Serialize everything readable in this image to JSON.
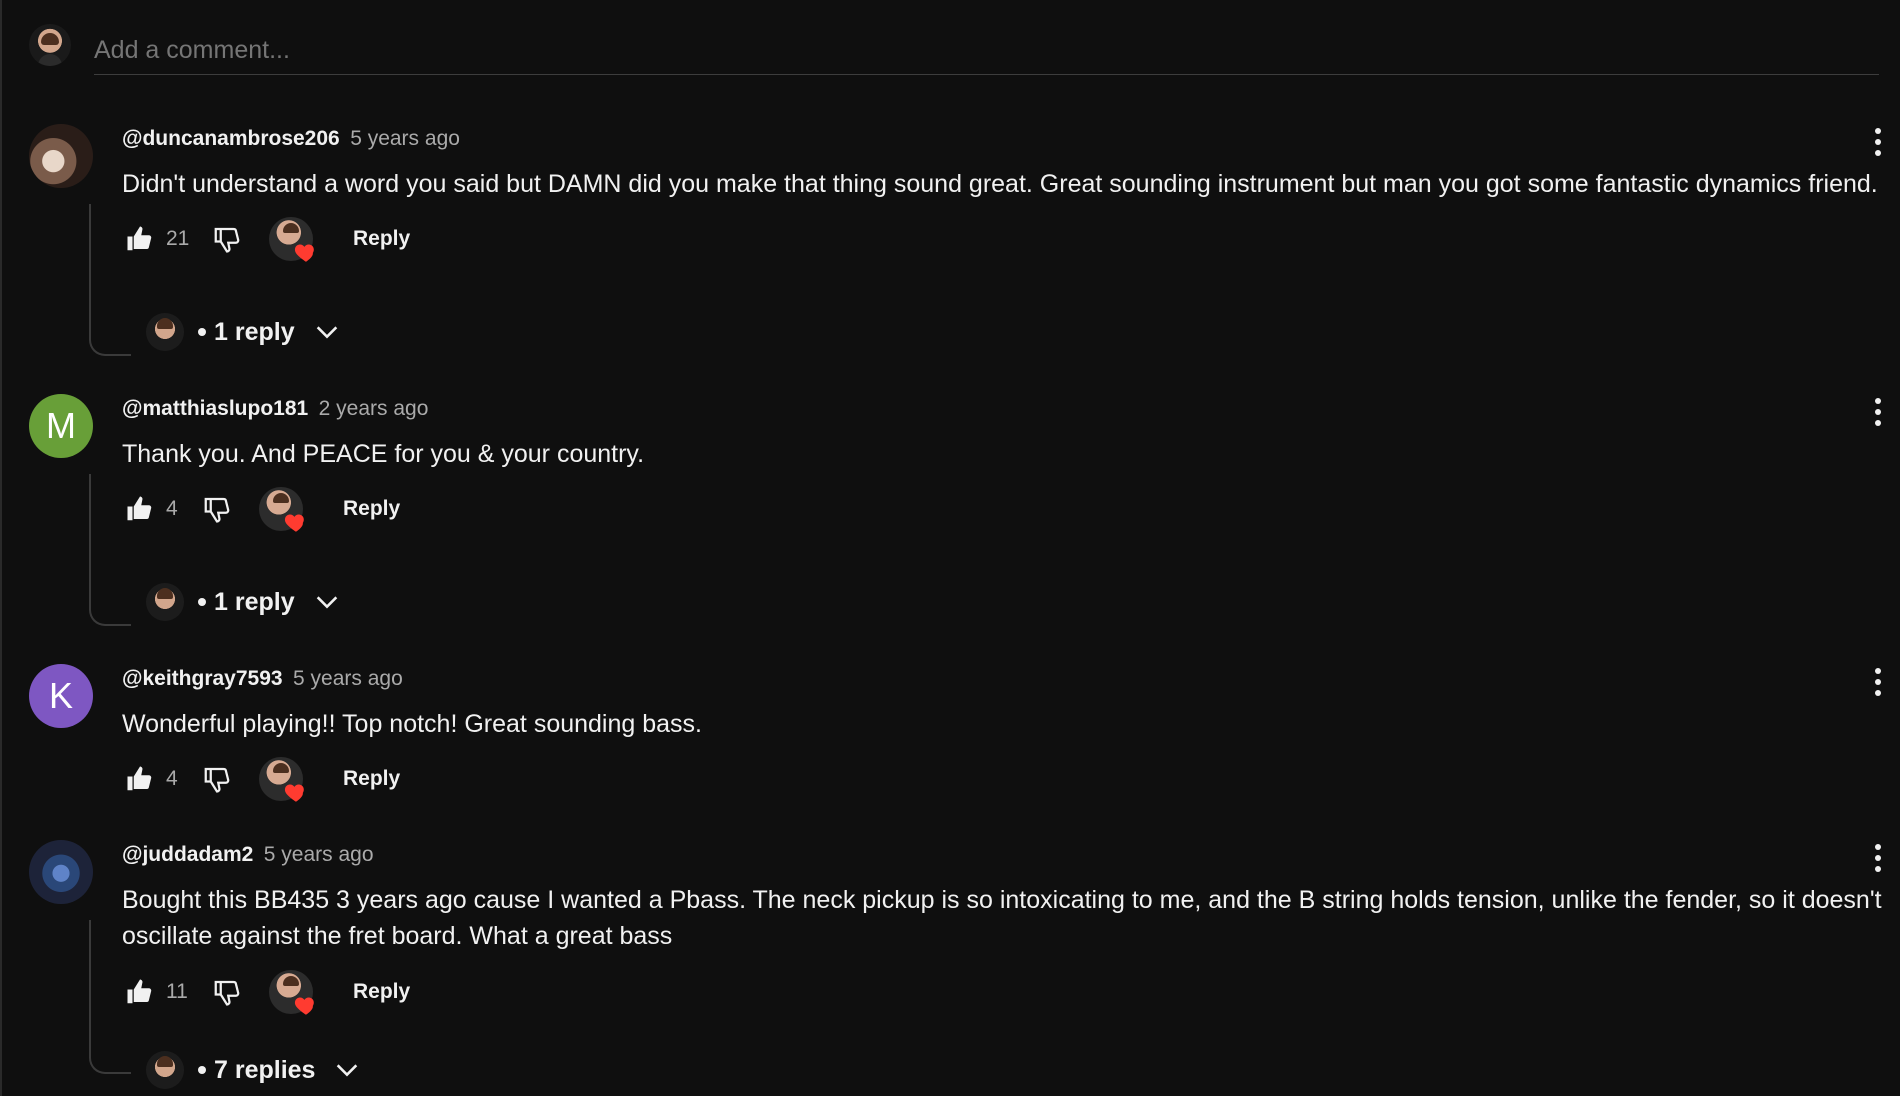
{
  "composer": {
    "placeholder": "Add a comment..."
  },
  "comments": [
    {
      "author": "@duncanambrose206",
      "time": "5 years ago",
      "text": "Didn't understand a word you said but DAMN did you make that thing sound great. Great sounding instrument but man you got some fantastic dynamics friend.",
      "likes": "21",
      "reply_label": "Reply",
      "replies_label": "1 reply",
      "avatar_icon": "user-photo-avatar"
    },
    {
      "author": "@matthiaslupo181",
      "time": "2 years ago",
      "text": "Thank you. And PEACE for you & your country.",
      "likes": "4",
      "reply_label": "Reply",
      "replies_label": "1 reply",
      "avatar_letter": "M",
      "avatar_color": "#689f38"
    },
    {
      "author": "@keithgray7593",
      "time": "5 years ago",
      "text": "Wonderful playing!! Top notch! Great sounding bass.",
      "likes": "4",
      "reply_label": "Reply",
      "avatar_letter": "K",
      "avatar_color": "#7e57c2"
    },
    {
      "author": "@juddadam2",
      "time": "5 years ago",
      "text": "Bought this BB435 3 years ago cause I wanted a Pbass.  The neck pickup is so intoxicating to me, and the B string holds tension, unlike the fender, so it doesn't oscillate against the fret board. What a great bass",
      "likes": "11",
      "reply_label": "Reply",
      "replies_label": "7 replies",
      "avatar_icon": "guitar-photo-avatar"
    }
  ],
  "icons": {
    "like": "thumbs-up-icon",
    "dislike": "thumbs-down-icon",
    "heart": "heart-icon",
    "more": "more-vertical-icon",
    "chevron": "chevron-down-icon"
  },
  "colors": {
    "background": "#0f0f0f",
    "heart": "#ff3b30",
    "secondary_text": "#aaaaaa"
  }
}
